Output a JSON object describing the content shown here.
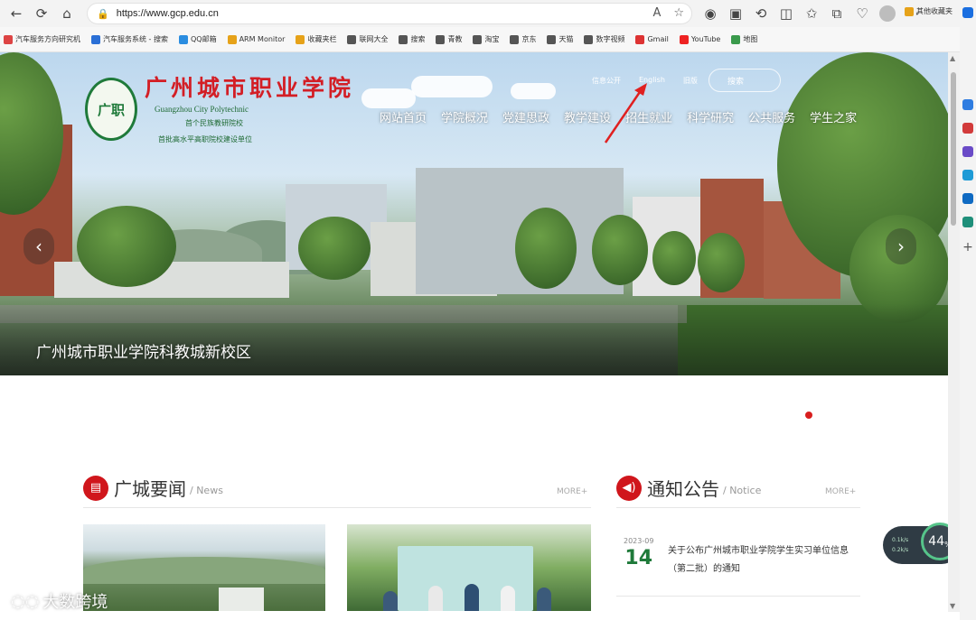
{
  "browser": {
    "url": "https://www.gcp.edu.cn",
    "nav_icons": [
      "back-icon",
      "refresh-icon",
      "home-icon"
    ],
    "bookmarks": [
      {
        "label": "汽车服务方向研究机",
        "color": "#d44"
      },
      {
        "label": "汽车服务系统 - 搜索",
        "color": "#2a6fd6"
      },
      {
        "label": "QQ邮箱",
        "color": "#2b8de0"
      },
      {
        "label": "ARM Monitor",
        "color": "#e6a219"
      },
      {
        "label": "收藏夹栏",
        "color": "#e6a219"
      },
      {
        "label": "联网大全",
        "color": "#555"
      },
      {
        "label": "搜索",
        "color": "#555"
      },
      {
        "label": "青教",
        "color": "#555"
      },
      {
        "label": "淘宝",
        "color": "#555"
      },
      {
        "label": "京东",
        "color": "#555"
      },
      {
        "label": "天猫",
        "color": "#555"
      },
      {
        "label": "数字视频",
        "color": "#555"
      },
      {
        "label": "Gmail",
        "color": "#d33"
      },
      {
        "label": "YouTube",
        "color": "#e22"
      },
      {
        "label": "地图",
        "color": "#3a9a4c"
      }
    ],
    "bookmark_other": "其他收藏夹"
  },
  "site": {
    "name_cn": "广州城市职业学院",
    "name_en": "Guangzhou City Polytechnic",
    "tagline1": "首个民族教研院校",
    "tagline2": "首批高水平高职院校建设单位",
    "logo_text": "广职",
    "top_links": [
      "信息公开",
      "English",
      "旧版"
    ],
    "search_placeholder": "搜索",
    "nav": [
      "网站首页",
      "学院概况",
      "党建思政",
      "教学建设",
      "招生就业",
      "科学研究",
      "公共服务",
      "学生之家"
    ],
    "slide_caption": "广州城市职业学院科教城新校区"
  },
  "news": {
    "title": "广城要闻",
    "subtitle": "/ News",
    "more": "MORE+"
  },
  "notice": {
    "title": "通知公告",
    "subtitle": "/ Notice",
    "more": "MORE+",
    "items": [
      {
        "year_month": "2023-09",
        "day": "14",
        "text": "关于公布广州城市职业学院学生实习单位信息（第二批）的通知"
      }
    ]
  },
  "widget": {
    "speed_value": "44",
    "speed_unit": "%",
    "speed_up": "0.1k/s",
    "speed_down": "0.2k/s"
  },
  "watermark": "大数跨境",
  "colors": {
    "brand_red": "#d0161c",
    "brand_green": "#1f7a3a"
  }
}
